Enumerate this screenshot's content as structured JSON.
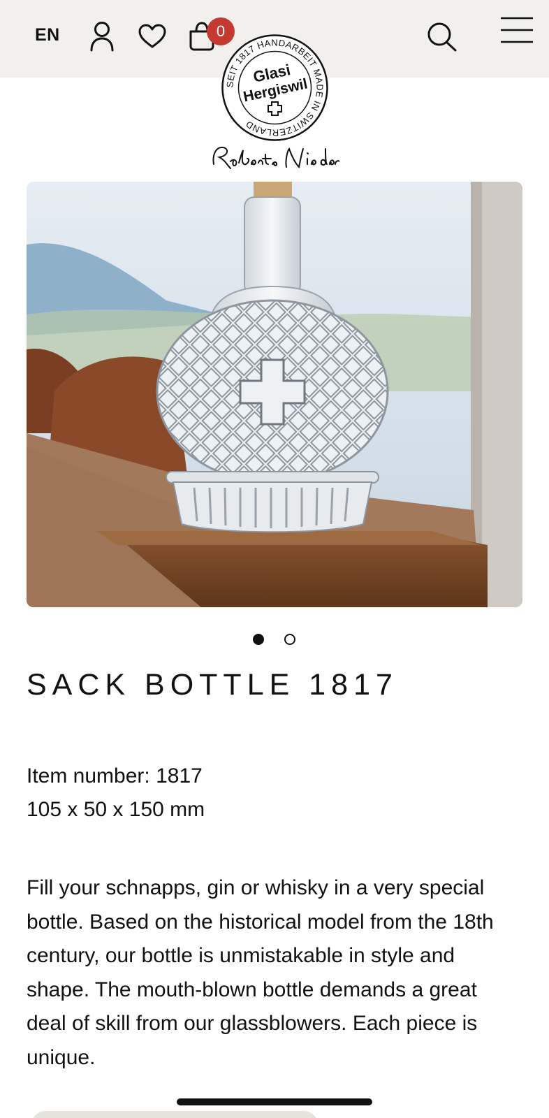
{
  "header": {
    "language": "EN",
    "cart_count": "0",
    "icons": [
      "user-icon",
      "heart-icon",
      "cart-icon",
      "search-icon",
      "menu-icon"
    ]
  },
  "logo": {
    "seal_name_line1": "Glasi",
    "seal_name_line2": "Hergiswil",
    "seal_ring_text": "SEIT 1817 HANDARBEIT MADE IN SWITZERLAND",
    "signature": "Robert Niederer"
  },
  "gallery": {
    "image_count": 2,
    "active_index": 0
  },
  "product": {
    "title": "SACK BOTTLE 1817",
    "item_number_label": "Item number:",
    "item_number": "1817",
    "dimensions": "105 x 50 x 150 mm",
    "description": "Fill your schnapps, gin or whisky in a very special bottle. Based on the historical model from the 18th century, our bottle is unmistakable in style and shape. The mouth-blown bottle demands a great deal of skill from our glassblowers. Each piece is unique."
  },
  "colors": {
    "header_bg": "#f1f0ed",
    "badge": "#c43a30",
    "text": "#111111"
  }
}
